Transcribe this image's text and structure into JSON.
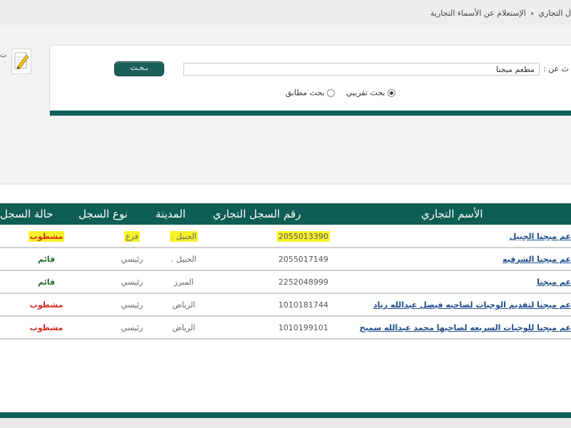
{
  "breadcrumb": {
    "items": [
      "ل التجاري",
      "الإستعلام عن الأسماء التجارية"
    ],
    "separator": "‹"
  },
  "sidebar": {
    "edit_text": "ت"
  },
  "search": {
    "label": "ث عن :",
    "input_value": "مطعم ميجنا",
    "button_label": "بـحـث",
    "options": [
      {
        "label": "بحث تقريبي",
        "checked": true
      },
      {
        "label": "بحث مطابق",
        "checked": false
      }
    ]
  },
  "table": {
    "columns": {
      "name": "الأسم التجاري",
      "number": "رقم السجل التجاري",
      "city": "المدينة",
      "type": "نوع السجل",
      "status": "حالة السجل"
    },
    "rows": [
      {
        "name": "عم ميجنا الجبيل",
        "number": "2055013390",
        "city": "الجبيل .",
        "type": "فرع",
        "status": "مشطوب",
        "status_color": "#d42a1c"
      },
      {
        "name": "عم ميجنا الشرقيه",
        "number": "2055017149",
        "city": "الجبيل .",
        "type": "رئيسي",
        "status": "قائم",
        "status_color": "#1e6b2a"
      },
      {
        "name": "عم ميجنا",
        "number": "2252048999",
        "city": "المبرز",
        "type": "رئيسي",
        "status": "قائم",
        "status_color": "#1e6b2a"
      },
      {
        "name": "عم ميجنا لتقديم الوجبات لصاحبه فيصل عبدالله زياد",
        "number": "1010181744",
        "city": "الرياض",
        "type": "رئيسي",
        "status": "مشطوب",
        "status_color": "#d42a1c"
      },
      {
        "name": "عم ميجنا للوجبات السريعه لصاحبها محمد عبدالله سميح",
        "number": "1010199101",
        "city": "الرياض",
        "type": "رئيسي",
        "status": "مشطوب",
        "status_color": "#d42a1c"
      }
    ]
  },
  "colors": {
    "primary": "#0e5e56",
    "link": "#1e4a8a",
    "highlight": "#f7f32a",
    "status_active": "#1e6b2a",
    "status_removed": "#d42a1c"
  },
  "icons": [
    "chevron-left-icon",
    "pencil-edit-icon",
    "radio-icon"
  ]
}
